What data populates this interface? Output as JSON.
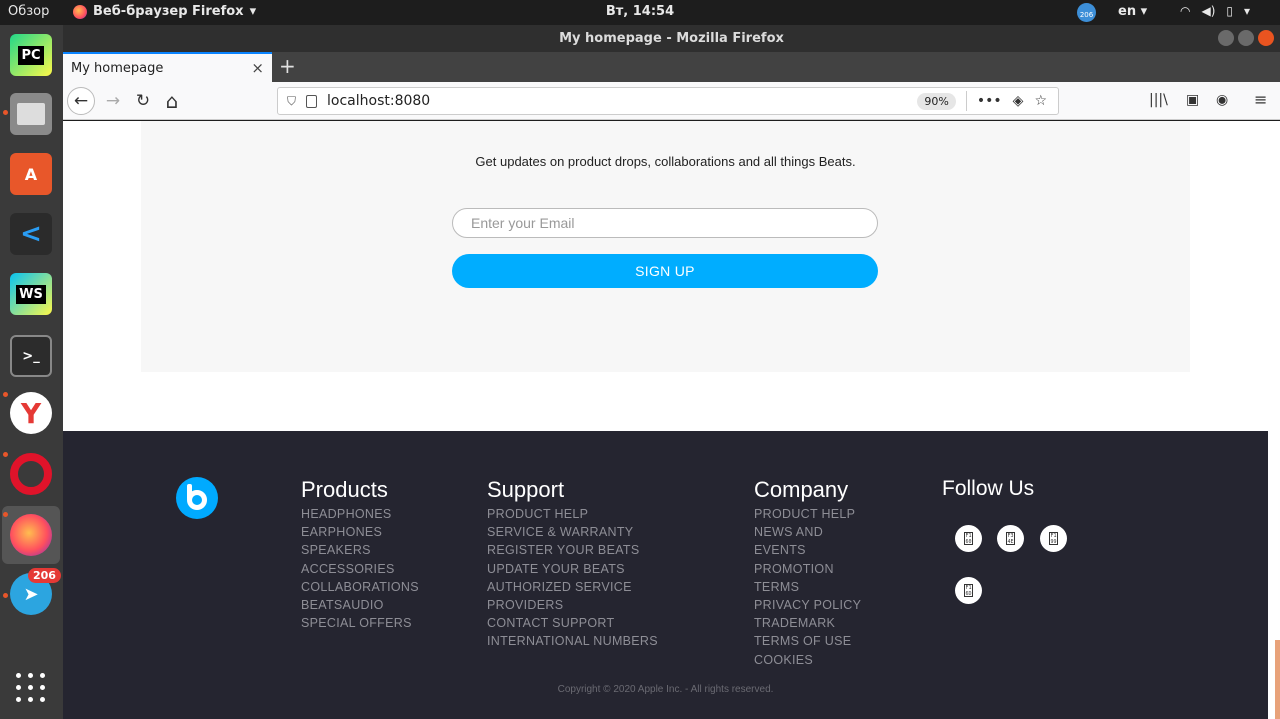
{
  "topbar": {
    "overview": "Обзор",
    "app_name": "Веб-браузер Firefox",
    "app_caret": "▾",
    "clock": "Вт, 14:54",
    "tray_badge": "206",
    "lang": "en ▾",
    "sys_icons": [
      "wifi-icon",
      "volume-icon",
      "battery-icon",
      "power-menu-icon"
    ]
  },
  "dock": {
    "apps": [
      "pycharm",
      "files",
      "software-center",
      "vscode",
      "webstorm",
      "terminal",
      "yandex-browser",
      "opera",
      "firefox",
      "telegram"
    ],
    "telegram_badge": "206",
    "pycharm_label": "PC",
    "webstorm_label": "WS",
    "yandex_label": "Y",
    "software_label": "A",
    "terminal_label": ">_"
  },
  "window": {
    "title": "My homepage - Mozilla Firefox"
  },
  "tab": {
    "title": "My homepage",
    "close": "×",
    "new_tab": "+"
  },
  "navbar": {
    "url": "localhost:8080",
    "zoom": "90%",
    "back": "←",
    "forward": "→",
    "reload": "↻",
    "home": "⌂",
    "more": "•••",
    "pocket": "◈",
    "bookmark_star": "☆",
    "library": "|||\\",
    "sidebar": "▣",
    "account": "◉",
    "menu": "≡"
  },
  "newsletter": {
    "text": "Get updates on product drops, collaborations and all things Beats.",
    "email_placeholder": "Enter your Email",
    "signup_label": "SIGN UP",
    "signup_color": "#00adff"
  },
  "footer": {
    "background": "#252530",
    "products": {
      "title": "Products",
      "items": [
        "HEADPHONES",
        "EARPHONES",
        "SPEAKERS",
        "ACCESSORIES",
        "COLLABORATIONS",
        "BEATSAUDIO",
        "SPECIAL OFFERS"
      ]
    },
    "support": {
      "title": "Support",
      "items": [
        "PRODUCT HELP",
        "SERVICE & WARRANTY",
        "REGISTER YOUR BEATS",
        "UPDATE YOUR BEATS",
        "AUTHORIZED SERVICE",
        "PROVIDERS",
        "CONTACT SUPPORT",
        "INTERNATIONAL NUMBERS"
      ]
    },
    "company": {
      "title": "Company",
      "items": [
        "PRODUCT HELP",
        "NEWS AND",
        "EVENTS",
        "PROMOTION",
        "TERMS",
        "PRIVACY POLICY",
        "TRADEMARK",
        "TERMS OF USE",
        "COOKIES"
      ]
    },
    "follow": {
      "title": "Follow Us",
      "icons": [
        {
          "name": "social-icon-1",
          "glyph": "F1 60"
        },
        {
          "name": "social-icon-2",
          "glyph": "F3 4E"
        },
        {
          "name": "social-icon-3",
          "glyph": "F1 99"
        },
        {
          "name": "social-icon-4",
          "glyph": "F1 6D"
        }
      ]
    },
    "copyright": "Copyright © 2020 Apple Inc. - All rights reserved."
  }
}
